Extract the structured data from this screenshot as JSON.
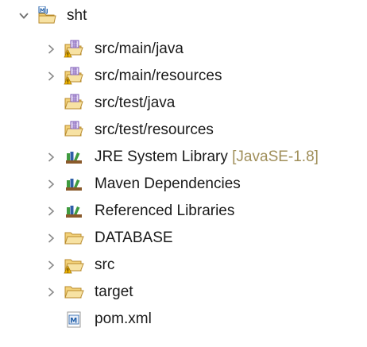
{
  "tree": {
    "project": {
      "label": "sht",
      "icon": "maven-project-icon",
      "expanded": true
    },
    "items": [
      {
        "label": "src/main/java",
        "icon": "source-folder-warning-icon",
        "expandable": true
      },
      {
        "label": "src/main/resources",
        "icon": "source-folder-warning-icon",
        "expandable": true
      },
      {
        "label": "src/test/java",
        "icon": "source-folder-icon",
        "expandable": false
      },
      {
        "label": "src/test/resources",
        "icon": "source-folder-icon",
        "expandable": false
      },
      {
        "label": "JRE System Library",
        "decoration": "[JavaSE-1.8]",
        "icon": "library-icon",
        "expandable": true
      },
      {
        "label": "Maven Dependencies",
        "icon": "library-icon",
        "expandable": true
      },
      {
        "label": "Referenced Libraries",
        "icon": "library-icon",
        "expandable": true
      },
      {
        "label": "DATABASE",
        "icon": "folder-icon",
        "expandable": true
      },
      {
        "label": "src",
        "icon": "folder-warning-icon",
        "expandable": true
      },
      {
        "label": "target",
        "icon": "folder-icon",
        "expandable": true
      },
      {
        "label": "pom.xml",
        "icon": "maven-pom-file-icon",
        "expandable": false
      }
    ]
  },
  "colors": {
    "twisty": "#7a7a7a",
    "folder": "#f3d27a",
    "folder_stroke": "#b98b2c",
    "warning": "#f0b400",
    "decoration": "#a08f5a",
    "library_green": "#3f9b3f",
    "library_blue": "#2f5fa8",
    "library_brown": "#8a5a2b"
  }
}
